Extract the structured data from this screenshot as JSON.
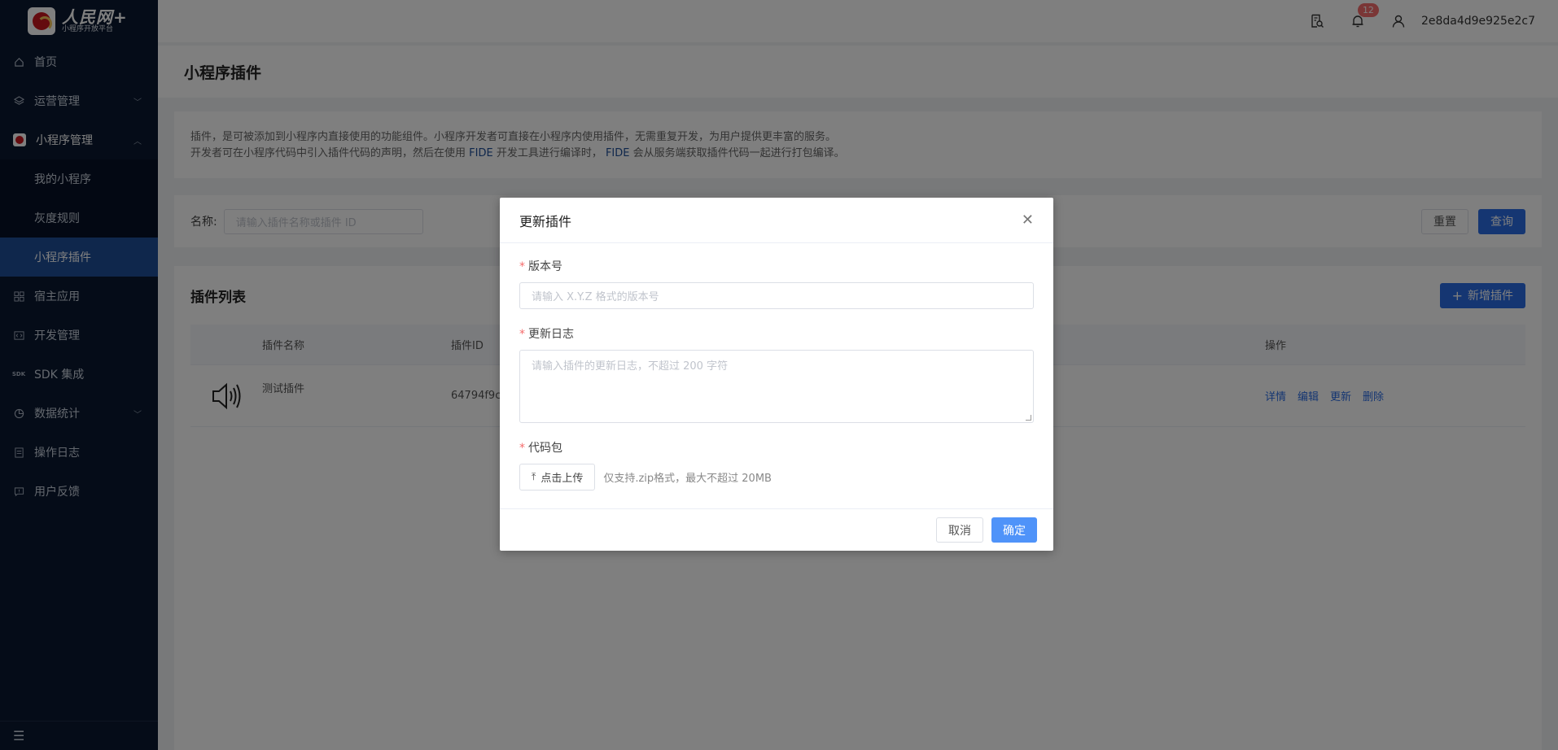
{
  "logo": {
    "title": "人民网+",
    "subtitle": "小程序开放平台"
  },
  "sidebar": {
    "items": [
      {
        "label": "首页",
        "icon": "home-icon"
      },
      {
        "label": "运营管理",
        "icon": "layers-icon"
      },
      {
        "label": "小程序管理",
        "icon": "brand-icon"
      },
      {
        "label": "我的小程序"
      },
      {
        "label": "灰度规则"
      },
      {
        "label": "小程序插件"
      },
      {
        "label": "宿主应用",
        "icon": "grid-icon"
      },
      {
        "label": "开发管理",
        "icon": "code-icon"
      },
      {
        "label": "SDK 集成",
        "icon": "sdk-icon"
      },
      {
        "label": "数据统计",
        "icon": "pie-icon"
      },
      {
        "label": "操作日志",
        "icon": "log-icon"
      },
      {
        "label": "用户反馈",
        "icon": "feedback-icon"
      }
    ]
  },
  "header": {
    "notification_count": "12",
    "user_id": "2e8da4d9e925e2c7"
  },
  "page": {
    "title": "小程序插件",
    "intro_line1": "插件，是可被添加到小程序内直接使用的功能组件。小程序开发者可直接在小程序内使用插件，无需重复开发，为用户提供更丰富的服务。",
    "intro_line2_a": "开发者可在小程序代码中引入插件代码的声明，然后在使用 ",
    "intro_fide1": "FIDE",
    "intro_line2_b": " 开发工具进行编译时， ",
    "intro_fide2": "FIDE",
    "intro_line2_c": " 会从服务端获取插件代码一起进行打包编译。"
  },
  "filter": {
    "label": "名称:",
    "placeholder": "请输入插件名称或插件 ID",
    "reset_label": "重置",
    "query_label": "查询"
  },
  "list": {
    "title": "插件列表",
    "add_label": "新增插件",
    "columns": [
      "插件名称",
      "插件ID",
      "操作"
    ],
    "rows": [
      {
        "name": "测试插件",
        "id": "64794f9ce",
        "ops": [
          "详情",
          "编辑",
          "更新",
          "删除"
        ]
      }
    ]
  },
  "dialog": {
    "title": "更新插件",
    "version_label": "版本号",
    "version_placeholder": "请输入 X.Y.Z 格式的版本号",
    "log_label": "更新日志",
    "log_placeholder": "请输入插件的更新日志，不超过 200 字符",
    "package_label": "代码包",
    "upload_label": "点击上传",
    "upload_tip": "仅支持.zip格式，最大不超过 20MB",
    "cancel_label": "取消",
    "confirm_label": "确定"
  },
  "colors": {
    "sidebar_bg": "#0a1931",
    "active_bg": "#1f4e98",
    "primary": "#2b6de5",
    "danger": "#f56c6c"
  }
}
